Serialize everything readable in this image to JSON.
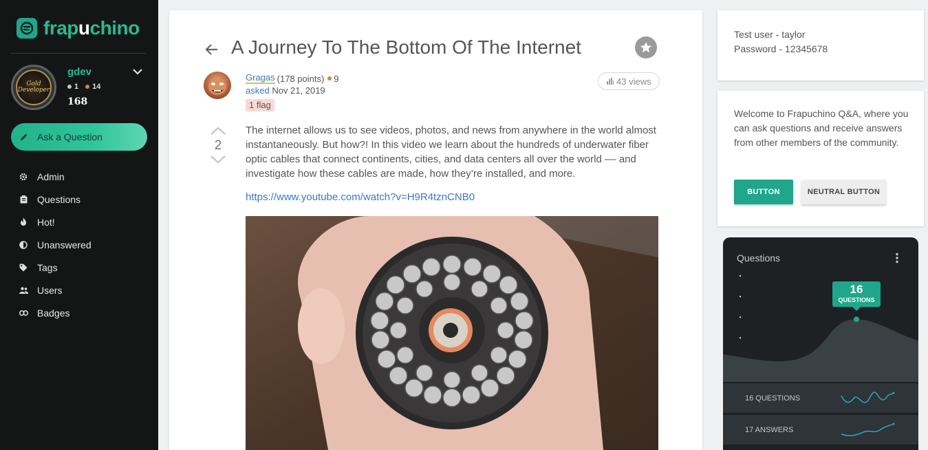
{
  "sidebar": {
    "logo": {
      "prefix": "frap",
      "highlight": "u",
      "suffix": "chino"
    },
    "user": {
      "name": "gdev",
      "silver_count": "1",
      "bronze_count": "14",
      "reputation": "168",
      "badge_text": "Gold Developer"
    },
    "ask_button": "Ask a Question",
    "nav": [
      {
        "label": "Admin",
        "icon": "gear-icon"
      },
      {
        "label": "Questions",
        "icon": "clipboard-icon"
      },
      {
        "label": "Hot!",
        "icon": "fire-icon"
      },
      {
        "label": "Unanswered",
        "icon": "half-circle-icon"
      },
      {
        "label": "Tags",
        "icon": "tag-icon"
      },
      {
        "label": "Users",
        "icon": "users-icon"
      },
      {
        "label": "Badges",
        "icon": "link-icon"
      }
    ]
  },
  "question": {
    "title": "A Journey To The Bottom Of The Internet",
    "author": "Gragas",
    "points": "(178 points)",
    "bronze_badges": "9",
    "asked_label": "asked",
    "asked_date": "Nov 21, 2019",
    "flag": "1 flag",
    "views": "43 views",
    "votes": "2",
    "body": "The internet allows us to see videos, photos, and news from anywhere in the world almost instantaneously. But how?! In this video we learn about the hundreds of underwater fiber optic cables that connect continents, cities, and data centers all over the world –– and investigate how these cables are made, how they’re installed, and more.",
    "link": "https://www.youtube.com/watch?v=H9R4tznCNB0"
  },
  "info": {
    "line1": "Test user - taylor",
    "line2": "Password - 12345678"
  },
  "welcome": {
    "text": "Welcome to Frapuchino Q&A, where you can ask questions and receive answers from other members of the community.",
    "button_primary": "BUTTON",
    "button_neutral": "NEUTRAL BUTTON"
  },
  "stats": {
    "title": "Questions",
    "tooltip_value": "16",
    "tooltip_label": "QUESTIONS",
    "rows": [
      {
        "label": "16 QUESTIONS"
      },
      {
        "label": "17 ANSWERS"
      }
    ]
  },
  "colors": {
    "accent": "#1fa68b",
    "sidebar": "#141616",
    "link": "#3b78c4"
  }
}
